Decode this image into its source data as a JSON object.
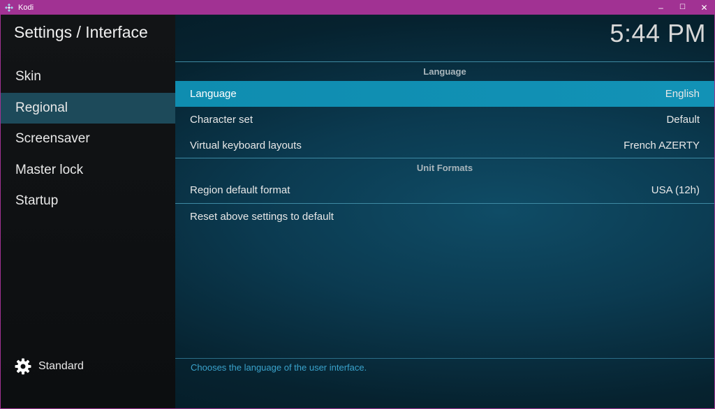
{
  "window": {
    "app_title": "Kodi",
    "controls": {
      "minimize": "–",
      "maximize": "☐",
      "close": "✕"
    }
  },
  "header": {
    "page_title": "Settings / Interface",
    "clock": "5:44 PM"
  },
  "sidebar": {
    "items": [
      {
        "label": "Skin"
      },
      {
        "label": "Regional"
      },
      {
        "label": "Screensaver"
      },
      {
        "label": "Master lock"
      },
      {
        "label": "Startup"
      }
    ],
    "footer_label": "Standard"
  },
  "settings": {
    "group_language": "Language",
    "language_label": "Language",
    "language_value": "English",
    "charset_label": "Character set",
    "charset_value": "Default",
    "vkb_label": "Virtual keyboard layouts",
    "vkb_value": "French AZERTY",
    "group_units": "Unit Formats",
    "region_label": "Region default format",
    "region_value": "USA (12h)",
    "reset_label": "Reset above settings to default"
  },
  "help_text": "Chooses the language of the user interface.",
  "colors": {
    "titlebar": "#a13293",
    "focus": "#1292b6",
    "sidebar_active": "#1d4a5a",
    "help_text": "#3aa3cc"
  }
}
